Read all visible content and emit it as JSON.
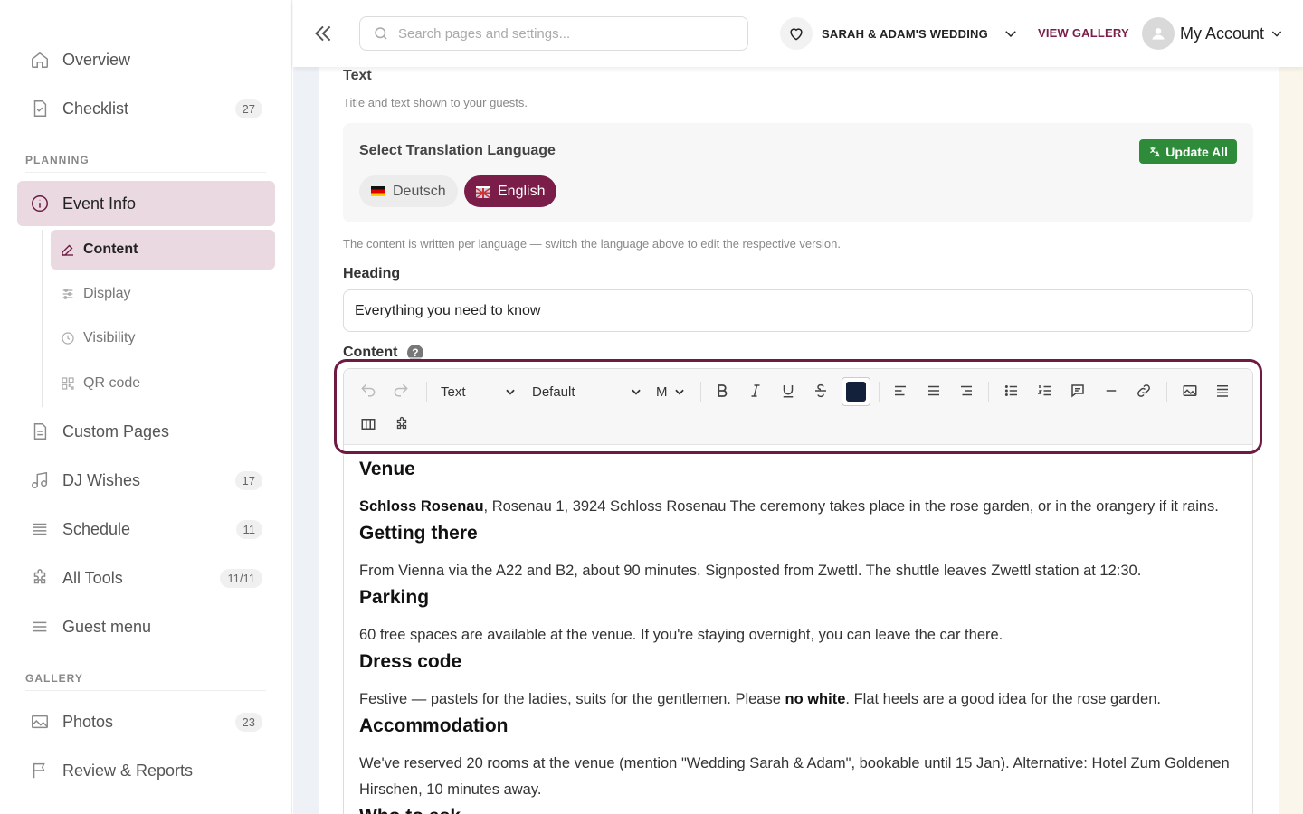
{
  "sidebar": {
    "items": [
      {
        "label": "Overview",
        "icon": "home-icon"
      },
      {
        "label": "Checklist",
        "icon": "checklist-icon",
        "badge": "27"
      }
    ],
    "planning_label": "PLANNING",
    "event_info": {
      "label": "Event Info",
      "icon": "info-icon"
    },
    "sub_items": [
      {
        "label": "Content",
        "icon": "edit-icon"
      },
      {
        "label": "Display",
        "icon": "sliders-icon"
      },
      {
        "label": "Visibility",
        "icon": "clock-icon"
      },
      {
        "label": "QR code",
        "icon": "qr-icon"
      }
    ],
    "planning_items": [
      {
        "label": "Custom Pages",
        "icon": "page-icon"
      },
      {
        "label": "DJ Wishes",
        "icon": "music-icon",
        "badge": "17"
      },
      {
        "label": "Schedule",
        "icon": "schedule-icon",
        "badge": "11"
      },
      {
        "label": "All Tools",
        "icon": "puzzle-icon",
        "badge": "11/11"
      },
      {
        "label": "Guest menu",
        "icon": "menu-icon"
      }
    ],
    "gallery_label": "GALLERY",
    "gallery_items": [
      {
        "label": "Photos",
        "icon": "photo-icon",
        "badge": "23"
      },
      {
        "label": "Review & Reports",
        "icon": "flag-icon"
      }
    ]
  },
  "topbar": {
    "search_placeholder": "Search pages and settings...",
    "wedding_name": "SARAH & ADAM'S WEDDING",
    "view_gallery": "VIEW GALLERY",
    "account": "My Account"
  },
  "main": {
    "section_title": "Text",
    "section_desc": "Title and text shown to your guests.",
    "translation": {
      "title": "Select Translation Language",
      "update_all": "Update All",
      "languages": [
        "Deutsch",
        "English"
      ],
      "selected": "English"
    },
    "hint": "The content is written per language — switch the language above to edit the respective version.",
    "heading_label": "Heading",
    "heading_value": "Everything you need to know",
    "content_label": "Content",
    "help_glyph": "?",
    "toolbar": {
      "block_type": "Text",
      "font": "Default",
      "size": "M",
      "text_color": "#14213a"
    },
    "content": {
      "venue_heading": "Venue",
      "venue_bold": "Schloss Rosenau",
      "venue_text": ", Rosenau 1, 3924 Schloss Rosenau The ceremony takes place in the rose garden, or in the orangery if it rains.",
      "getting_heading": "Getting there",
      "getting_text": "From Vienna via the A22 and B2, about 90 minutes. Signposted from Zwettl. The shuttle leaves Zwettl station at 12:30.",
      "parking_heading": "Parking",
      "parking_text": "60 free spaces are available at the venue. If you're staying overnight, you can leave the car there.",
      "dress_heading": "Dress code",
      "dress_text_1": "Festive — pastels for the ladies, suits for the gentlemen. Please ",
      "dress_bold": "no white",
      "dress_text_2": ". Flat heels are a good idea for the rose garden.",
      "accom_heading": "Accommodation",
      "accom_text": "We've reserved 20 rooms at the venue (mention \"Wedding Sarah & Adam\", bookable until 15 Jan). Alternative: Hotel Zum Goldenen Hirschen, 10 minutes away.",
      "who_heading": "Who to ask"
    }
  },
  "colors": {
    "brand": "#7a1d48",
    "active_bg": "#ead9e0",
    "update_green": "#2e8b3a"
  }
}
